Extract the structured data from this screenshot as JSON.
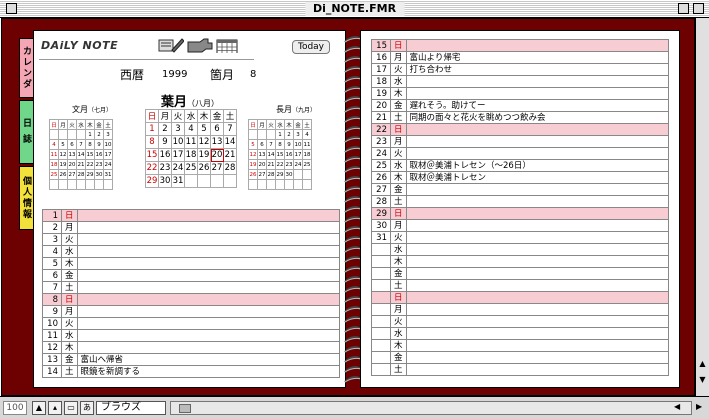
{
  "window": {
    "title": "Di_NOTE.FMR"
  },
  "tabs": [
    {
      "label": "カレンダ",
      "color": "#f4a6b4"
    },
    {
      "label": "日 誌",
      "color": "#6fd68a"
    },
    {
      "label": "個人情報",
      "color": "#f2e13a"
    }
  ],
  "header": {
    "logo": "DAiLY NOTE",
    "today_button": "Today"
  },
  "era": {
    "year_label": "西暦",
    "year": "1999",
    "month_label": "箇月",
    "month": "8",
    "month_name": "葉月",
    "month_name_paren": "（八月）"
  },
  "mini_prev": {
    "title": "文月",
    "paren": "（七月）",
    "rows": [
      [
        "",
        "",
        "",
        "",
        "1",
        "2",
        "3"
      ],
      [
        "4",
        "5",
        "6",
        "7",
        "8",
        "9",
        "10"
      ],
      [
        "11",
        "12",
        "13",
        "14",
        "15",
        "16",
        "17"
      ],
      [
        "18",
        "19",
        "20",
        "21",
        "22",
        "23",
        "24"
      ],
      [
        "25",
        "26",
        "27",
        "28",
        "29",
        "30",
        "31"
      ],
      [
        "",
        "",
        "",
        "",
        "",
        "",
        ""
      ]
    ]
  },
  "mini_next": {
    "title": "長月",
    "paren": "（九月）",
    "rows": [
      [
        "",
        "",
        "",
        "1",
        "2",
        "3",
        "4"
      ],
      [
        "5",
        "6",
        "7",
        "8",
        "9",
        "10",
        "11"
      ],
      [
        "12",
        "13",
        "14",
        "15",
        "16",
        "17",
        "18"
      ],
      [
        "19",
        "20",
        "21",
        "22",
        "23",
        "24",
        "25"
      ],
      [
        "26",
        "27",
        "28",
        "29",
        "30",
        "",
        ""
      ],
      [
        "",
        "",
        "",
        "",
        "",
        "",
        ""
      ]
    ]
  },
  "weekdays": [
    "日",
    "月",
    "火",
    "水",
    "木",
    "金",
    "土"
  ],
  "main_cal": {
    "rows": [
      [
        "1",
        "2",
        "3",
        "4",
        "5",
        "6",
        "7"
      ],
      [
        "8",
        "9",
        "10",
        "11",
        "12",
        "13",
        "14"
      ],
      [
        "15",
        "16",
        "17",
        "18",
        "19",
        "20",
        "21"
      ],
      [
        "22",
        "23",
        "24",
        "25",
        "26",
        "27",
        "28"
      ],
      [
        "29",
        "30",
        "31",
        "",
        "",
        "",
        ""
      ]
    ],
    "today": "20"
  },
  "diary_left": [
    {
      "d": "1",
      "w": "日",
      "note": "",
      "sun": true
    },
    {
      "d": "2",
      "w": "月",
      "note": ""
    },
    {
      "d": "3",
      "w": "火",
      "note": ""
    },
    {
      "d": "4",
      "w": "水",
      "note": ""
    },
    {
      "d": "5",
      "w": "木",
      "note": ""
    },
    {
      "d": "6",
      "w": "金",
      "note": ""
    },
    {
      "d": "7",
      "w": "土",
      "note": ""
    },
    {
      "d": "8",
      "w": "日",
      "note": "",
      "sun": true
    },
    {
      "d": "9",
      "w": "月",
      "note": ""
    },
    {
      "d": "10",
      "w": "火",
      "note": ""
    },
    {
      "d": "11",
      "w": "水",
      "note": ""
    },
    {
      "d": "12",
      "w": "木",
      "note": ""
    },
    {
      "d": "13",
      "w": "金",
      "note": "富山へ帰省"
    },
    {
      "d": "14",
      "w": "土",
      "note": "眼鏡を新調する"
    }
  ],
  "diary_right": [
    {
      "d": "15",
      "w": "日",
      "note": "",
      "sun": true
    },
    {
      "d": "16",
      "w": "月",
      "note": "富山より帰宅"
    },
    {
      "d": "17",
      "w": "火",
      "note": "打ち合わせ"
    },
    {
      "d": "18",
      "w": "水",
      "note": ""
    },
    {
      "d": "19",
      "w": "木",
      "note": ""
    },
    {
      "d": "20",
      "w": "金",
      "note": "遅れそう。助けてー"
    },
    {
      "d": "21",
      "w": "土",
      "note": "同期の面々と花火を眺めつつ飲み会"
    },
    {
      "d": "22",
      "w": "日",
      "note": "",
      "sun": true
    },
    {
      "d": "23",
      "w": "月",
      "note": ""
    },
    {
      "d": "24",
      "w": "火",
      "note": ""
    },
    {
      "d": "25",
      "w": "水",
      "note": "取材＠美浦トレセン（～26日）"
    },
    {
      "d": "26",
      "w": "木",
      "note": "取材＠美浦トレセン"
    },
    {
      "d": "27",
      "w": "金",
      "note": ""
    },
    {
      "d": "28",
      "w": "土",
      "note": ""
    },
    {
      "d": "29",
      "w": "日",
      "note": "",
      "sun": true
    },
    {
      "d": "30",
      "w": "月",
      "note": ""
    },
    {
      "d": "31",
      "w": "火",
      "note": ""
    },
    {
      "d": "",
      "w": "水",
      "note": ""
    },
    {
      "d": "",
      "w": "木",
      "note": ""
    },
    {
      "d": "",
      "w": "金",
      "note": ""
    },
    {
      "d": "",
      "w": "土",
      "note": ""
    },
    {
      "d": "",
      "w": "日",
      "note": "",
      "sun": true
    },
    {
      "d": "",
      "w": "月",
      "note": ""
    },
    {
      "d": "",
      "w": "火",
      "note": ""
    },
    {
      "d": "",
      "w": "水",
      "note": ""
    },
    {
      "d": "",
      "w": "木",
      "note": ""
    },
    {
      "d": "",
      "w": "金",
      "note": ""
    },
    {
      "d": "",
      "w": "土",
      "note": ""
    }
  ],
  "status": {
    "zoom": "100",
    "mode": "ブラウズ"
  },
  "colors": {
    "frame": "#6d0000",
    "sunday_row": "#f7cdd3",
    "sunday_text": "#cc0000"
  }
}
